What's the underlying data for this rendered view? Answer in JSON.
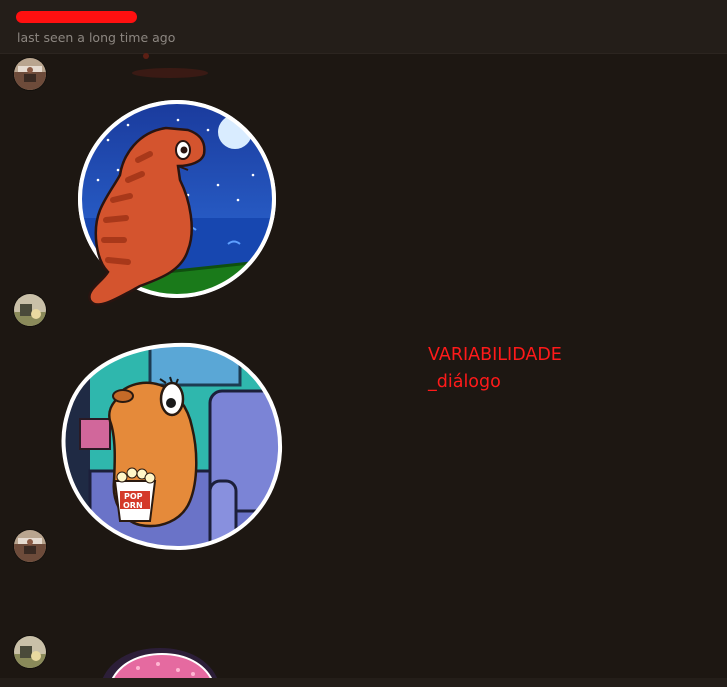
{
  "header": {
    "contact_name_redacted": true,
    "status": "last seen a long time ago"
  },
  "messages": [
    {
      "sender": "contact",
      "type": "sticker",
      "sticker": "fragment (cut off at top)"
    },
    {
      "sender": "contact",
      "type": "sticker",
      "sticker": "dinosaur-looking-at-night-sea"
    },
    {
      "sender": "self",
      "type": "sticker",
      "sticker": "capybara-eating-popcorn-on-sofa"
    },
    {
      "sender": "contact",
      "type": "empty"
    },
    {
      "sender": "self",
      "type": "sticker",
      "sticker": "pink-sticker (cut off at bottom)"
    }
  ],
  "annotation": {
    "line1": "VARIABILIDADE",
    "line2": "_diálogo"
  },
  "colors": {
    "background": "#1d1712",
    "header": "#241e19",
    "redaction": "#ff1010",
    "annotation": "#ff1a1a"
  },
  "icons": [
    "avatar-contact",
    "avatar-self"
  ]
}
